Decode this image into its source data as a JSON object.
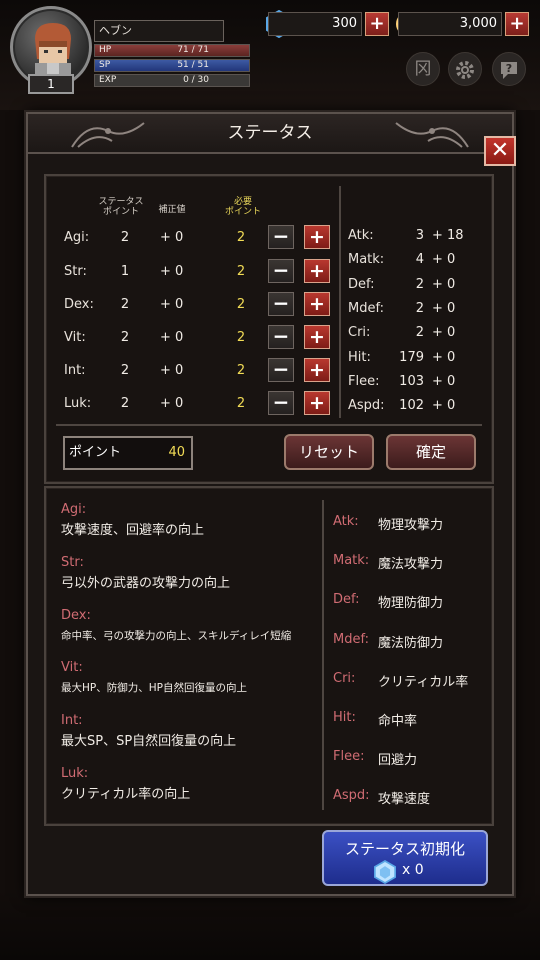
{
  "hud": {
    "level": "1",
    "name": "ヘブン",
    "hp_label": "HP",
    "hp_value": "71 / 71",
    "sp_label": "SP",
    "sp_value": "51 / 51",
    "exp_label": "EXP",
    "exp_value": "0 / 30",
    "gems": "300",
    "gold": "3,000",
    "menu_icon_glyph": "冈",
    "icons": [
      "gem-icon",
      "gold-coin-icon",
      "plus-icon",
      "inventory-icon",
      "gear-icon",
      "help-icon"
    ]
  },
  "dialog": {
    "title": "ステータス",
    "close_glyph": "✕",
    "headers": {
      "points": "ステータス\nポイント",
      "bonus": "補正値",
      "required": "必要\nポイント"
    },
    "stats": [
      {
        "label": "Agi:",
        "value": "2",
        "bonus": "+ 0",
        "cost": "2"
      },
      {
        "label": "Str:",
        "value": "1",
        "bonus": "+ 0",
        "cost": "2"
      },
      {
        "label": "Dex:",
        "value": "2",
        "bonus": "+ 0",
        "cost": "2"
      },
      {
        "label": "Vit:",
        "value": "2",
        "bonus": "+ 0",
        "cost": "2"
      },
      {
        "label": "Int:",
        "value": "2",
        "bonus": "+ 0",
        "cost": "2"
      },
      {
        "label": "Luk:",
        "value": "2",
        "bonus": "+ 0",
        "cost": "2"
      }
    ],
    "minus_glyph": "−",
    "plus_glyph": "+",
    "substats": [
      {
        "label": "Atk:",
        "value": "3",
        "bonus": "+ 18"
      },
      {
        "label": "Matk:",
        "value": "4",
        "bonus": "+ 0"
      },
      {
        "label": "Def:",
        "value": "2",
        "bonus": "+ 0"
      },
      {
        "label": "Mdef:",
        "value": "2",
        "bonus": "+ 0"
      },
      {
        "label": "Cri:",
        "value": "2",
        "bonus": "+ 0"
      },
      {
        "label": "Hit:",
        "value": "179",
        "bonus": "+ 0"
      },
      {
        "label": "Flee:",
        "value": "103",
        "bonus": "+ 0"
      },
      {
        "label": "Aspd:",
        "value": "102",
        "bonus": "+ 0"
      }
    ],
    "points_label": "ポイント",
    "points_value": "40",
    "reset_label": "リセット",
    "confirm_label": "確定",
    "descriptions": [
      {
        "title": "Agi:",
        "text": "攻撃速度、回避率の向上"
      },
      {
        "title": "Str:",
        "text": "弓以外の武器の攻撃力の向上"
      },
      {
        "title": "Dex:",
        "text": "命中率、弓の攻撃力の向上、スキルディレイ短縮"
      },
      {
        "title": "Vit:",
        "text": "最大HP、防御力、HP自然回復量の向上"
      },
      {
        "title": "Int:",
        "text": "最大SP、SP自然回復量の向上"
      },
      {
        "title": "Luk:",
        "text": "クリティカル率の向上"
      }
    ],
    "sub_descriptions": [
      {
        "title": "Atk:",
        "text": "物理攻撃力"
      },
      {
        "title": "Matk:",
        "text": "魔法攻撃力"
      },
      {
        "title": "Def:",
        "text": "物理防御力"
      },
      {
        "title": "Mdef:",
        "text": "魔法防御力"
      },
      {
        "title": "Cri:",
        "text": "クリティカル率"
      },
      {
        "title": "Hit:",
        "text": "命中率"
      },
      {
        "title": "Flee:",
        "text": "回避力"
      },
      {
        "title": "Aspd:",
        "text": "攻撃速度"
      }
    ],
    "reinit_label": "ステータス初期化",
    "reinit_count": "x 0"
  },
  "colors": {
    "accent_red": "#b8382f",
    "highlight_yellow": "#f2dc56",
    "desc_title_pink": "#d06c73",
    "reinit_blue": "#2d41ad"
  }
}
